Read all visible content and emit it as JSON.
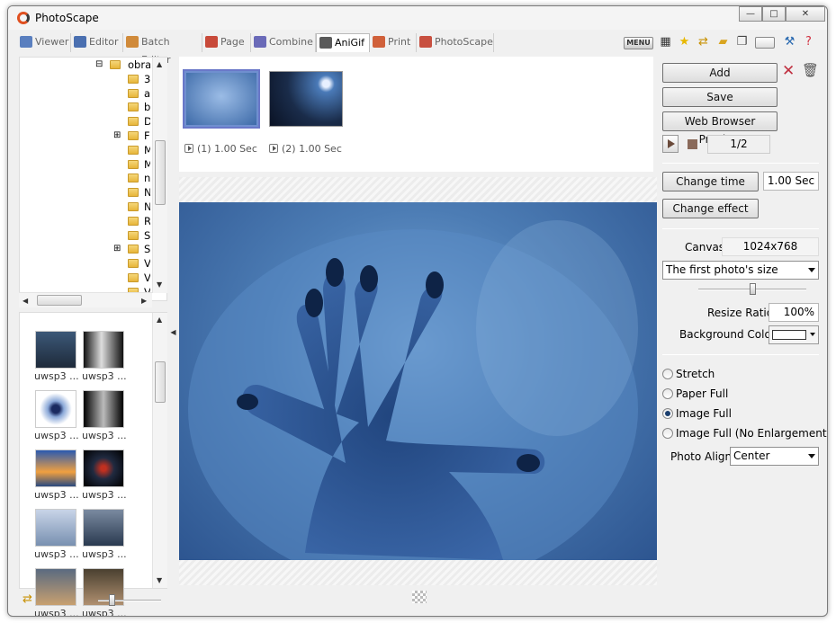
{
  "window": {
    "title": "PhotoScape",
    "min": "—",
    "max": "□",
    "close": "✕"
  },
  "tabs": [
    {
      "label": "Viewer",
      "color": "#5a7fbf"
    },
    {
      "label": "Editor",
      "color": "#4a6fb0"
    },
    {
      "label": "Batch Editor",
      "color": "#d08a3a"
    },
    {
      "label": "Page",
      "color": "#c84a3a"
    },
    {
      "label": "Combine",
      "color": "#6a6ab8"
    },
    {
      "label": "AniGif",
      "color": "#5a5a5a"
    },
    {
      "label": "Print",
      "color": "#d0603a"
    },
    {
      "label": "PhotoScape",
      "color": "#c85040"
    }
  ],
  "toolbar": {
    "menu_label": "MENU"
  },
  "tree": {
    "items": [
      {
        "label": "obra",
        "expand": "⊟"
      },
      {
        "label": "3",
        "expand": ""
      },
      {
        "label": "a",
        "expand": ""
      },
      {
        "label": "b",
        "expand": ""
      },
      {
        "label": "D",
        "expand": ""
      },
      {
        "label": "F",
        "expand": "⊞"
      },
      {
        "label": "M",
        "expand": ""
      },
      {
        "label": "M",
        "expand": ""
      },
      {
        "label": "n",
        "expand": ""
      },
      {
        "label": "N",
        "expand": ""
      },
      {
        "label": "N",
        "expand": ""
      },
      {
        "label": "R",
        "expand": ""
      },
      {
        "label": "S",
        "expand": ""
      },
      {
        "label": "S",
        "expand": "⊞"
      },
      {
        "label": "V",
        "expand": ""
      },
      {
        "label": "V",
        "expand": ""
      },
      {
        "label": "V",
        "expand": ""
      }
    ]
  },
  "thumbnails": [
    {
      "label": "uwsp3 ..."
    },
    {
      "label": "uwsp3 ..."
    },
    {
      "label": "uwsp3 ..."
    },
    {
      "label": "uwsp3 ..."
    },
    {
      "label": "uwsp3 ..."
    },
    {
      "label": "uwsp3 ..."
    },
    {
      "label": "uwsp3 ..."
    },
    {
      "label": "uwsp3 ..."
    },
    {
      "label": "uwsp3 ..."
    },
    {
      "label": "uwsp3 ..."
    }
  ],
  "frames": [
    {
      "label": "(1) 1.00 Sec",
      "selected": true
    },
    {
      "label": "(2) 1.00 Sec",
      "selected": false
    }
  ],
  "panel": {
    "add": "Add",
    "save": "Save",
    "web_preview": "Web Browser Preview",
    "frame_counter": "1/2",
    "change_time": "Change time",
    "time_value": "1.00 Sec",
    "change_effect": "Change effect",
    "canvas_label": "Canvas",
    "canvas_value": "1024x768",
    "size_option": "The first photo's size",
    "resize_label": "Resize Ratio",
    "resize_value": "100%",
    "bg_label": "Background Color",
    "bg_color": "#ffffff",
    "radios": [
      {
        "label": "Stretch",
        "checked": false
      },
      {
        "label": "Paper Full",
        "checked": false
      },
      {
        "label": "Image Full",
        "checked": true
      },
      {
        "label": "Image Full (No Enlargement)",
        "checked": false
      }
    ],
    "align_label": "Photo Align",
    "align_value": "Center"
  }
}
